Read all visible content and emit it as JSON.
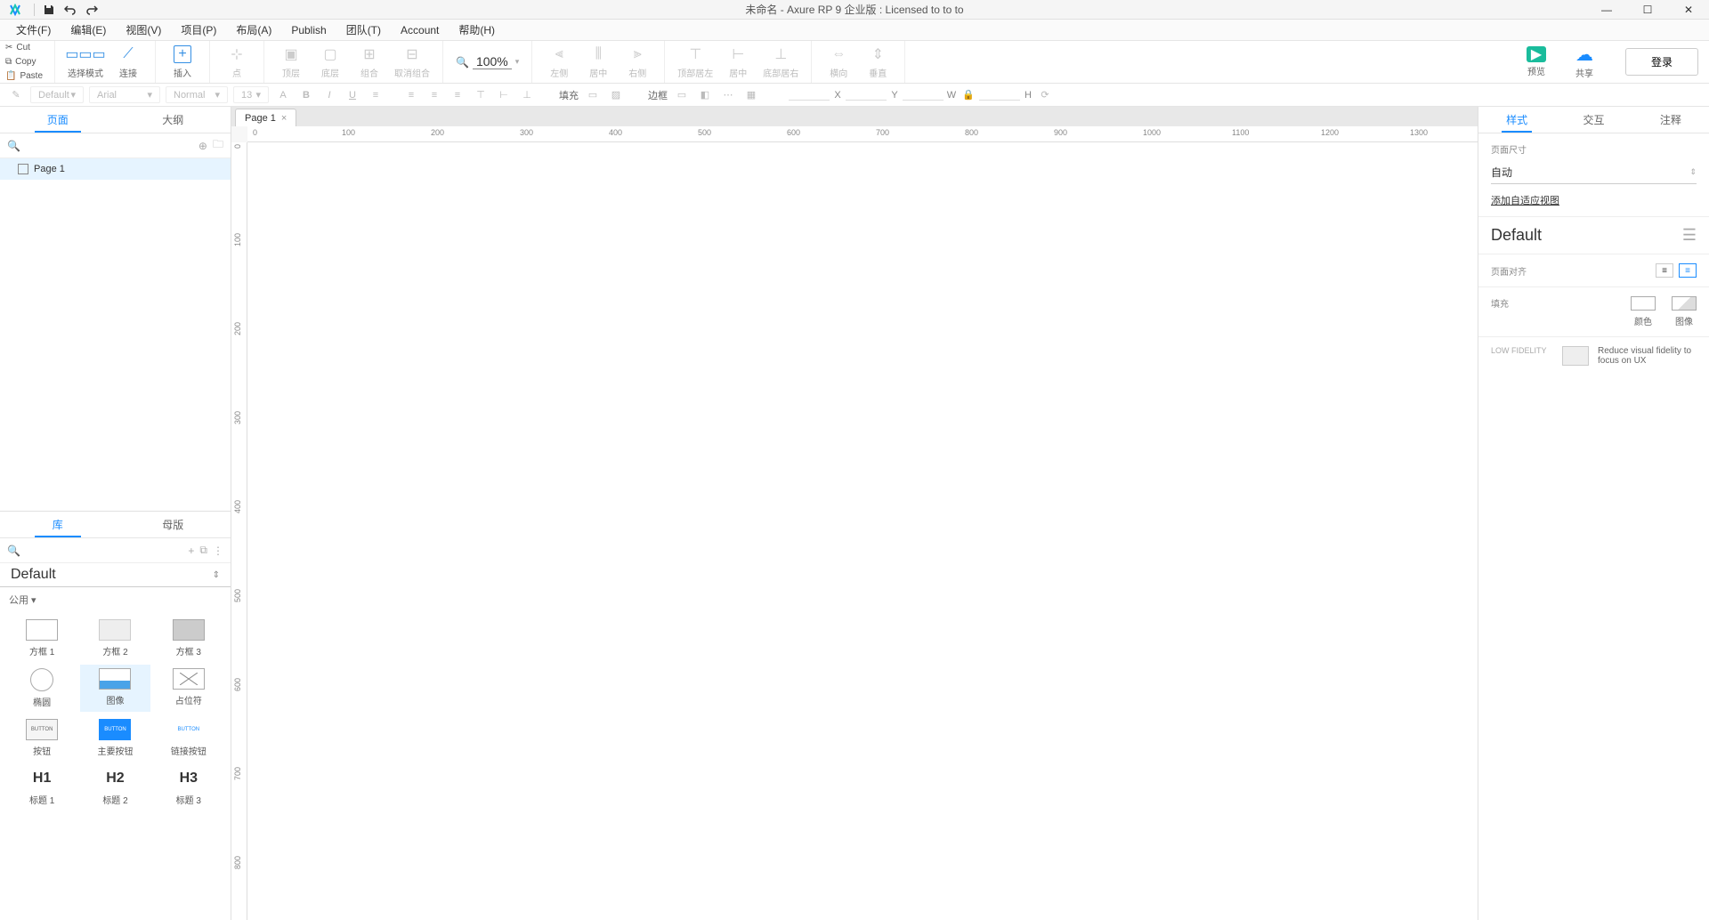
{
  "title": "未命名 - Axure RP 9 企业版 : Licensed to to to",
  "menu": [
    "文件(F)",
    "编辑(E)",
    "视图(V)",
    "项目(P)",
    "布局(A)",
    "Publish",
    "团队(T)",
    "Account",
    "帮助(H)"
  ],
  "clip": {
    "cut": "Cut",
    "copy": "Copy",
    "paste": "Paste"
  },
  "toolbar": {
    "select": "选择模式",
    "connect": "连接",
    "insert": "插入",
    "point": "点",
    "top": "顶层",
    "bottom": "底层",
    "group": "组合",
    "ungroup": "取消组合",
    "zoom": "100%",
    "alignL": "左侧",
    "alignC": "居中",
    "alignR": "右侧",
    "alignT": "顶部居左",
    "alignM": "居中",
    "alignB": "底部居右",
    "distH": "横向",
    "distV": "垂直",
    "preview": "预览",
    "share": "共享",
    "login": "登录"
  },
  "format": {
    "style": "Default",
    "font": "Arial",
    "weight": "Normal",
    "size": "13",
    "fill": "填充",
    "border": "边框",
    "x": "X",
    "y": "Y",
    "w": "W",
    "h": "H"
  },
  "leftTabs": {
    "pages": "页面",
    "outline": "大纲"
  },
  "pages": [
    {
      "name": "Page 1"
    }
  ],
  "docTab": "Page 1",
  "libTabs": {
    "lib": "库",
    "master": "母版"
  },
  "libName": "Default",
  "libCat": "公用 ▾",
  "widgets": [
    {
      "name": "方框 1",
      "type": "rect"
    },
    {
      "name": "方框 2",
      "type": "grey"
    },
    {
      "name": "方框 3",
      "type": "dark"
    },
    {
      "name": "椭圆",
      "type": "circle"
    },
    {
      "name": "图像",
      "type": "img",
      "selected": true
    },
    {
      "name": "占位符",
      "type": "ph"
    },
    {
      "name": "按钮",
      "type": "btn",
      "txt": "BUTTON"
    },
    {
      "name": "主要按钮",
      "type": "pbtn",
      "txt": "BUTTON"
    },
    {
      "name": "链接按钮",
      "type": "lbtn",
      "txt": "BUTTON"
    },
    {
      "name": "标题 1",
      "type": "h",
      "txt": "H1"
    },
    {
      "name": "标题 2",
      "type": "h",
      "txt": "H2"
    },
    {
      "name": "标题 3",
      "type": "h",
      "txt": "H3"
    }
  ],
  "rightTabs": {
    "style": "样式",
    "interact": "交互",
    "note": "注释"
  },
  "right": {
    "dimLabel": "页面尺寸",
    "dimValue": "自动",
    "adaptive": "添加自适应视图",
    "defaultTitle": "Default",
    "alignLabel": "页面对齐",
    "fillLabel": "填充",
    "fillColor": "颜色",
    "fillImage": "图像",
    "lofiLabel": "LOW FIDELITY",
    "lofiText": "Reduce visual fidelity to focus on UX"
  },
  "rulerH": [
    0,
    100,
    200,
    300,
    400,
    500,
    600,
    700,
    800,
    900,
    1000,
    1100,
    1200,
    1300
  ],
  "rulerV": [
    0,
    100,
    200,
    300,
    400,
    500,
    600,
    700,
    800
  ]
}
